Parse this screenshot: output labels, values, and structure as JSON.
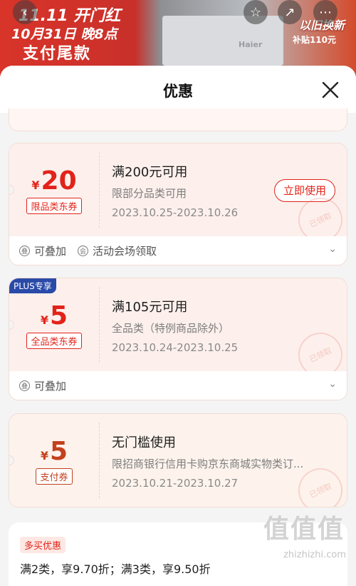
{
  "banner": {
    "line1": "11.11 开门红",
    "line2": "10月31日 晚8点",
    "line3": "支付尾款",
    "brand": "Haier",
    "trade_in": "以旧换新",
    "trade_in_sub": "补贴110元"
  },
  "sheet": {
    "title": "优惠"
  },
  "coupons": [
    {
      "currency": "¥",
      "amount": "20",
      "tag": "限品类东券",
      "condition": "满200元可用",
      "scope": "限部分品类可用",
      "dates": "2023.10.25-2023.10.26",
      "action": "立即使用",
      "stamp": "已领取",
      "footer": [
        "可叠加",
        "活动会场领取"
      ]
    },
    {
      "badge": "PLUS专享",
      "currency": "¥",
      "amount": "5",
      "tag": "全品类东券",
      "condition": "满105元可用",
      "scope": "全品类（特例商品除外）",
      "dates": "2023.10.24-2023.10.25",
      "stamp": "已领取",
      "footer": [
        "可叠加"
      ]
    },
    {
      "currency": "¥",
      "amount": "5",
      "tag": "支付券",
      "condition": "无门槛使用",
      "scope": "限招商银行信用卡购京东商城实物类订...",
      "dates": "2023.10.21-2023.10.27",
      "stamp": "已领取"
    }
  ],
  "multi_buy": {
    "badge": "多买优惠",
    "text": "满2类，享9.70折；满3类，享9.50折"
  },
  "watermark": {
    "main": "值值值",
    "sub": "zhizhizhi.com"
  }
}
